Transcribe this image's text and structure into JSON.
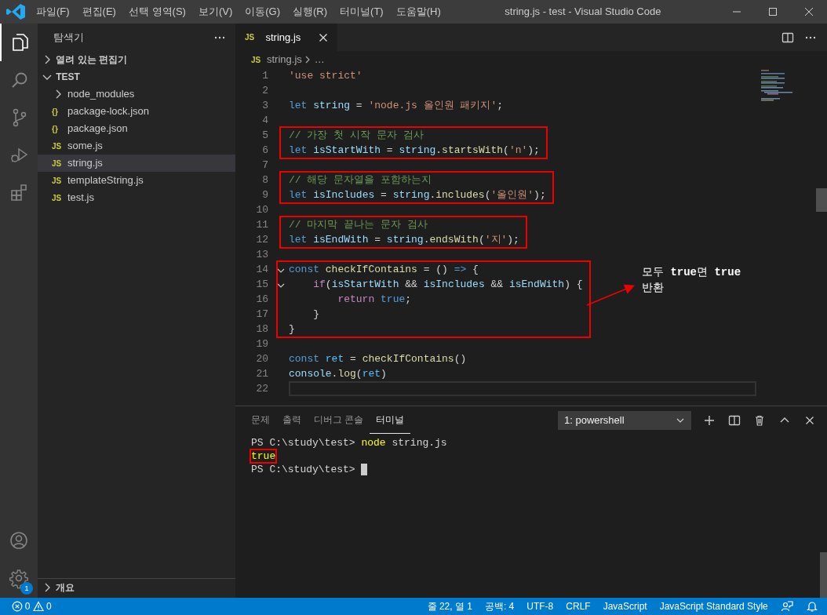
{
  "window": {
    "title": "string.js - test - Visual Studio Code",
    "menu": [
      "파일(F)",
      "편집(E)",
      "선택 영역(S)",
      "보기(V)",
      "이동(G)",
      "실행(R)",
      "터미널(T)",
      "도움말(H)"
    ]
  },
  "activity_bar": {
    "items": [
      {
        "kind": "explorer",
        "selected": true
      },
      {
        "kind": "search",
        "selected": false
      },
      {
        "kind": "source-control",
        "selected": false
      },
      {
        "kind": "debug",
        "selected": false
      },
      {
        "kind": "extensions",
        "selected": false
      }
    ],
    "bottom": [
      {
        "kind": "account"
      },
      {
        "kind": "settings",
        "badge": "1"
      }
    ]
  },
  "sidebar": {
    "title": "탐색기",
    "sections": [
      {
        "label": "열려 있는 편집기",
        "expanded": false
      },
      {
        "label": "TEST",
        "expanded": true,
        "items": [
          {
            "label": "node_modules",
            "kind": "folder",
            "expanded": false,
            "selected": false
          },
          {
            "label": "package-lock.json",
            "kind": "json",
            "icon": "{}",
            "selected": false
          },
          {
            "label": "package.json",
            "kind": "json",
            "icon": "{}",
            "selected": false
          },
          {
            "label": "some.js",
            "kind": "js",
            "icon": "JS",
            "selected": false
          },
          {
            "label": "string.js",
            "kind": "js",
            "icon": "JS",
            "selected": true
          },
          {
            "label": "templateString.js",
            "kind": "js",
            "icon": "JS",
            "selected": false
          },
          {
            "label": "test.js",
            "kind": "js",
            "icon": "JS",
            "selected": false
          }
        ]
      }
    ],
    "footer_section": {
      "label": "개요",
      "expanded": false
    }
  },
  "editor": {
    "tabs": [
      {
        "icon": "JS",
        "label": "string.js",
        "selected": true
      }
    ],
    "breadcrumb": {
      "icon": "JS",
      "file": "string.js",
      "rest": "…"
    },
    "code": [
      {
        "boxed": false,
        "lines": [
          {
            "n": "1",
            "current": false,
            "tokens": [
              {
                "kind": "str",
                "text": "'use strict'"
              }
            ]
          },
          {
            "n": "2",
            "current": false
          },
          {
            "n": "3",
            "current": false,
            "tokens": [
              {
                "kind": "kw",
                "text": "let "
              },
              {
                "kind": "var",
                "text": "string"
              },
              {
                "kind": "pl",
                "text": " = "
              },
              {
                "kind": "str",
                "text": "'node.js 올인원 패키지'"
              },
              {
                "kind": "pl",
                "text": ";"
              }
            ]
          },
          {
            "n": "4",
            "current": false
          }
        ]
      },
      {
        "boxed": true,
        "lines": [
          {
            "n": "5",
            "current": false,
            "tokens": [
              {
                "kind": "cm",
                "text": "// 가장 첫 시작 문자 검사"
              }
            ]
          },
          {
            "n": "6",
            "current": false,
            "tokens": [
              {
                "kind": "kw",
                "text": "let "
              },
              {
                "kind": "var",
                "text": "isStartWith"
              },
              {
                "kind": "pl",
                "text": " = "
              },
              {
                "kind": "var",
                "text": "string"
              },
              {
                "kind": "pl",
                "text": "."
              },
              {
                "kind": "fn",
                "text": "startsWith"
              },
              {
                "kind": "pl",
                "text": "("
              },
              {
                "kind": "str",
                "text": "'n'"
              },
              {
                "kind": "pl",
                "text": ");"
              }
            ]
          }
        ]
      },
      {
        "boxed": false,
        "lines": [
          {
            "n": "7",
            "current": false
          }
        ]
      },
      {
        "boxed": true,
        "lines": [
          {
            "n": "8",
            "current": false,
            "tokens": [
              {
                "kind": "cm",
                "text": "// 해당 문자열을 포함하는지"
              }
            ]
          },
          {
            "n": "9",
            "current": false,
            "tokens": [
              {
                "kind": "kw",
                "text": "let "
              },
              {
                "kind": "var",
                "text": "isIncludes"
              },
              {
                "kind": "pl",
                "text": " = "
              },
              {
                "kind": "var",
                "text": "string"
              },
              {
                "kind": "pl",
                "text": "."
              },
              {
                "kind": "fn",
                "text": "includes"
              },
              {
                "kind": "pl",
                "text": "("
              },
              {
                "kind": "str",
                "text": "'올인원'"
              },
              {
                "kind": "pl",
                "text": ");"
              }
            ]
          }
        ]
      },
      {
        "boxed": false,
        "lines": [
          {
            "n": "10",
            "current": false
          }
        ]
      },
      {
        "boxed": true,
        "lines": [
          {
            "n": "11",
            "current": false,
            "tokens": [
              {
                "kind": "cm",
                "text": "// 마지막 끝나는 문자 검사"
              }
            ]
          },
          {
            "n": "12",
            "current": false,
            "tokens": [
              {
                "kind": "kw",
                "text": "let "
              },
              {
                "kind": "var",
                "text": "isEndWith"
              },
              {
                "kind": "pl",
                "text": " = "
              },
              {
                "kind": "var",
                "text": "string"
              },
              {
                "kind": "pl",
                "text": "."
              },
              {
                "kind": "fn",
                "text": "endsWith"
              },
              {
                "kind": "pl",
                "text": "("
              },
              {
                "kind": "str",
                "text": "'지'"
              },
              {
                "kind": "pl",
                "text": ");"
              }
            ]
          }
        ]
      },
      {
        "boxed": false,
        "lines": [
          {
            "n": "13",
            "current": false
          }
        ]
      },
      {
        "boxed": true,
        "lines": [
          {
            "n": "14",
            "current": false,
            "fold_expanded": true,
            "tokens": [
              {
                "kind": "kw",
                "text": "const "
              },
              {
                "kind": "fn",
                "text": "checkIfContains"
              },
              {
                "kind": "pl",
                "text": " = () "
              },
              {
                "kind": "kw",
                "text": "=>"
              },
              {
                "kind": "pl",
                "text": " {"
              }
            ]
          },
          {
            "n": "15",
            "current": false,
            "fold_expanded": true,
            "tokens": [
              {
                "kind": "ctl",
                "text": "    if"
              },
              {
                "kind": "pl",
                "text": "("
              },
              {
                "kind": "var",
                "text": "isStartWith"
              },
              {
                "kind": "pl",
                "text": " && "
              },
              {
                "kind": "var",
                "text": "isIncludes"
              },
              {
                "kind": "pl",
                "text": " && "
              },
              {
                "kind": "var",
                "text": "isEndWith"
              },
              {
                "kind": "pl",
                "text": ") {"
              }
            ]
          },
          {
            "n": "16",
            "current": false,
            "tokens": [
              {
                "kind": "ctl",
                "text": "        return "
              },
              {
                "kind": "kw",
                "text": "true"
              },
              {
                "kind": "pl",
                "text": ";"
              }
            ]
          },
          {
            "n": "17",
            "current": false,
            "tokens": [
              {
                "kind": "pl",
                "text": "    }"
              }
            ]
          },
          {
            "n": "18",
            "current": false,
            "tokens": [
              {
                "kind": "pl",
                "text": "}"
              }
            ]
          }
        ]
      },
      {
        "boxed": false,
        "lines": [
          {
            "n": "19",
            "current": false
          },
          {
            "n": "20",
            "current": false,
            "tokens": [
              {
                "kind": "kw",
                "text": "const "
              },
              {
                "kind": "cst",
                "text": "ret"
              },
              {
                "kind": "pl",
                "text": " = "
              },
              {
                "kind": "fn",
                "text": "checkIfContains"
              },
              {
                "kind": "pl",
                "text": "()"
              }
            ]
          },
          {
            "n": "21",
            "current": false,
            "tokens": [
              {
                "kind": "var",
                "text": "console"
              },
              {
                "kind": "pl",
                "text": "."
              },
              {
                "kind": "fn",
                "text": "log"
              },
              {
                "kind": "pl",
                "text": "("
              },
              {
                "kind": "cst",
                "text": "ret"
              },
              {
                "kind": "pl",
                "text": ")"
              }
            ]
          },
          {
            "n": "22",
            "current": true
          }
        ]
      }
    ],
    "annotation": {
      "lines": [
        "모두 **true**면 **true**",
        "반환"
      ]
    }
  },
  "panel": {
    "tabs": [
      {
        "label": "문제",
        "selected": false
      },
      {
        "label": "출력",
        "selected": false
      },
      {
        "label": "디버그 콘솔",
        "selected": false
      },
      {
        "label": "터미널",
        "selected": true
      }
    ],
    "terminal_select": "1: powershell",
    "terminal": [
      {
        "cursor": false,
        "tokens": [
          {
            "kind": "pl",
            "text": "PS C:\\study\\test> ",
            "boxed": false
          },
          {
            "kind": "cmd",
            "text": "node",
            "boxed": false
          },
          {
            "kind": "pl",
            "text": " string.js",
            "boxed": false
          }
        ]
      },
      {
        "cursor": false,
        "tokens": [
          {
            "kind": "cmd",
            "text": "true",
            "boxed": true
          }
        ]
      },
      {
        "cursor": true,
        "tokens": [
          {
            "kind": "pl",
            "text": "PS C:\\study\\test> ",
            "boxed": false
          }
        ]
      }
    ]
  },
  "status_bar": {
    "errors": "0",
    "warnings": "0",
    "items": [
      "줄 22, 열 1",
      "공백: 4",
      "UTF-8",
      "CRLF",
      "JavaScript",
      "JavaScript Standard Style"
    ]
  }
}
